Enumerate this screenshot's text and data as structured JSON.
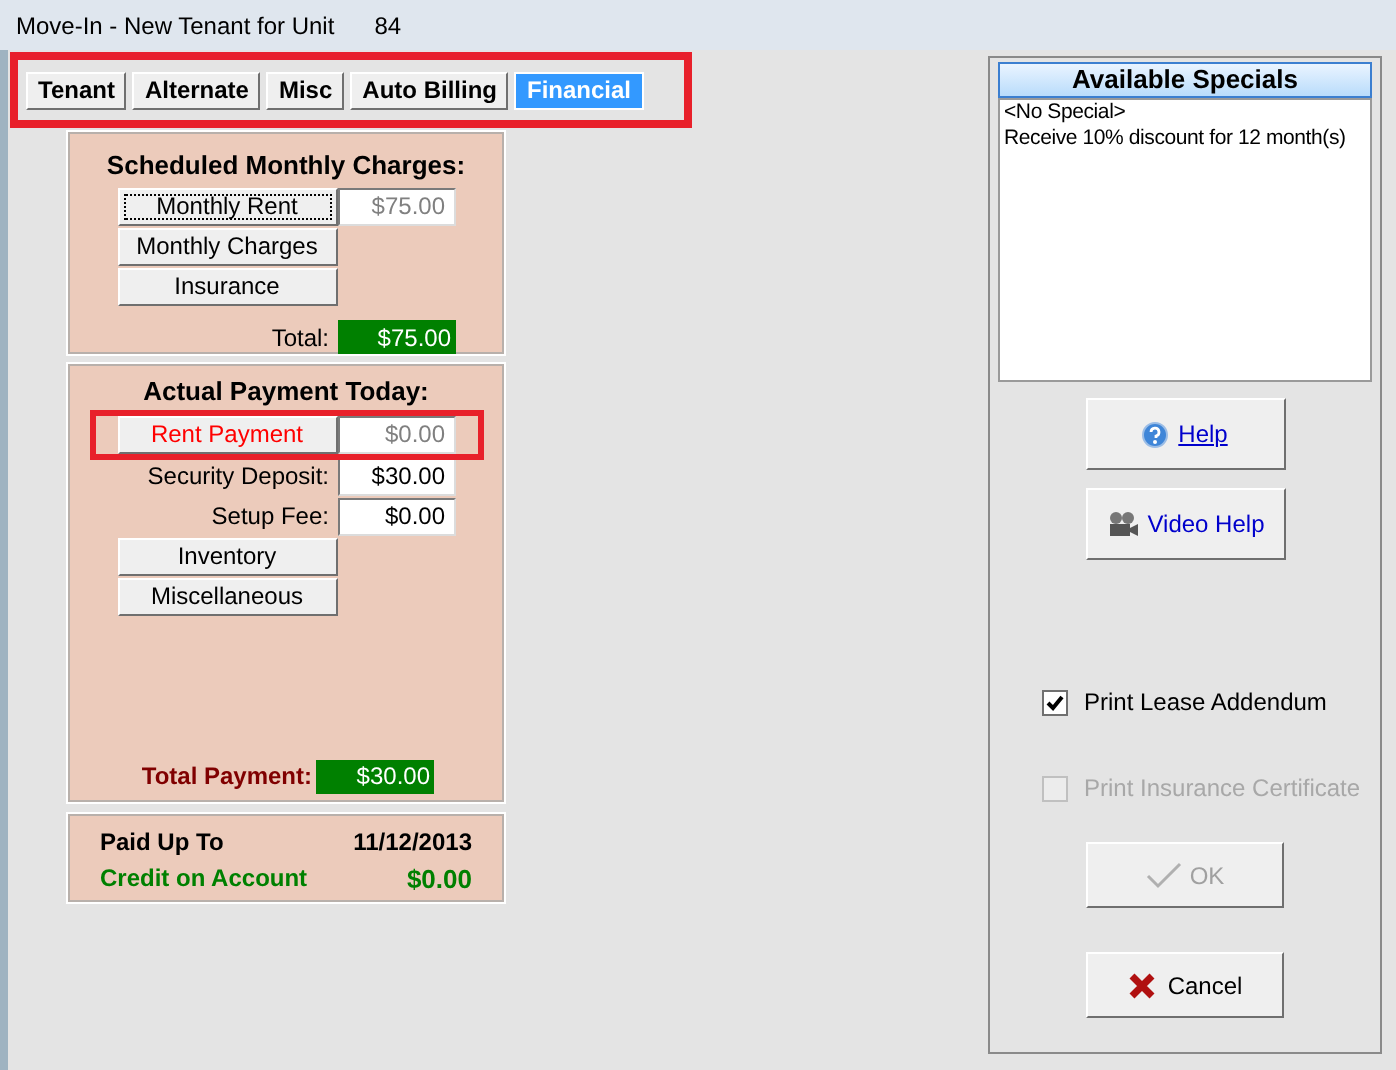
{
  "window": {
    "title": "Move-In - New Tenant for Unit",
    "unit": "84"
  },
  "tabs": [
    {
      "label": "Tenant",
      "selected": false
    },
    {
      "label": "Alternate",
      "selected": false
    },
    {
      "label": "Misc",
      "selected": false
    },
    {
      "label": "Auto Billing",
      "selected": false
    },
    {
      "label": "Financial",
      "selected": true
    }
  ],
  "scheduled": {
    "title": "Scheduled Monthly Charges:",
    "rows": [
      {
        "kind": "button",
        "label": "Monthly Rent",
        "value": "$75.00",
        "focused": true,
        "highlight": false
      },
      {
        "kind": "button",
        "label": "Monthly Charges",
        "focused": false,
        "highlight": false
      },
      {
        "kind": "button",
        "label": "Insurance",
        "focused": false,
        "highlight": false
      }
    ],
    "total_label": "Total:",
    "total": "$75.00"
  },
  "payment": {
    "title": "Actual Payment Today:",
    "rows": [
      {
        "kind": "button",
        "label": "Rent Payment",
        "value": "$0.00",
        "focused": false,
        "highlight": true
      },
      {
        "kind": "label",
        "label": "Security Deposit:",
        "value": "$30.00",
        "highlight": false
      },
      {
        "kind": "label",
        "label": "Setup Fee:",
        "value": "$0.00",
        "highlight": false
      },
      {
        "kind": "button",
        "label": "Inventory",
        "focused": false,
        "highlight": false
      },
      {
        "kind": "button",
        "label": "Miscellaneous",
        "focused": false,
        "highlight": false
      }
    ],
    "total_label": "Total Payment:",
    "total": "$30.00"
  },
  "summary": {
    "paid_label": "Paid Up To",
    "paid_date": "11/12/2013",
    "credit_label": "Credit on Account",
    "credit": "$0.00"
  },
  "specials": {
    "title": "Available Specials",
    "items": [
      "<No Special>",
      "Receive 10% discount for 12 month(s)"
    ]
  },
  "help_buttons": [
    {
      "kind": "help",
      "label": "Help"
    },
    {
      "kind": "video",
      "label": "Video Help"
    }
  ],
  "options": [
    {
      "label": "Print Lease Addendum",
      "checked": true,
      "disabled": false
    },
    {
      "label": "Print Insurance Certificate",
      "checked": false,
      "disabled": true
    }
  ],
  "ok": {
    "label": "OK",
    "disabled": true
  },
  "cancel": {
    "label": "Cancel"
  }
}
